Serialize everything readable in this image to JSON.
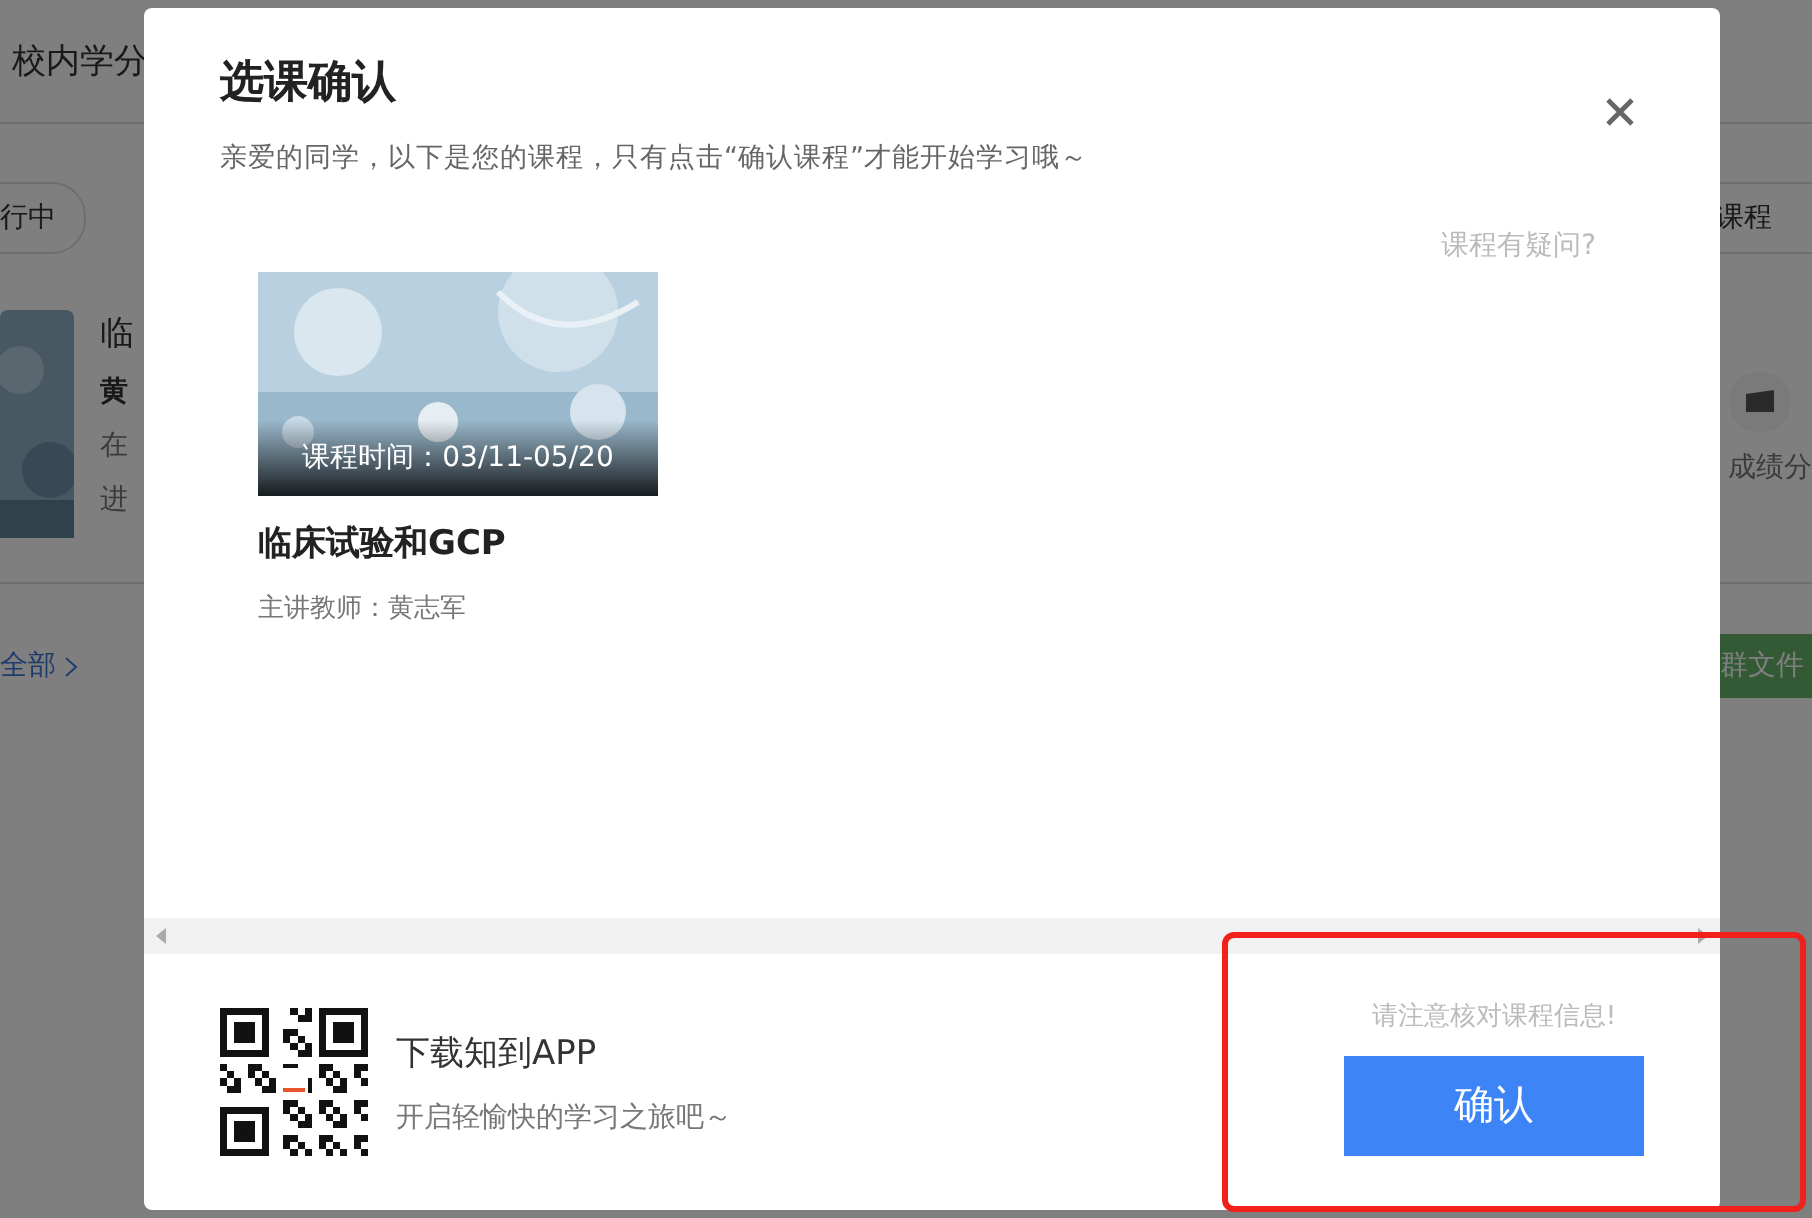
{
  "background_page": {
    "header_title": "校内学分",
    "filter_left": "行中",
    "filter_right": "课程",
    "course": {
      "title": "临",
      "teacher": "黄",
      "status": "在",
      "progress": "进"
    },
    "side_action": "成绩分",
    "view_all": "全部",
    "group_files": "群文件"
  },
  "dialog": {
    "title": "选课确认",
    "subtitle": "亲爱的同学，以下是您的课程，只有点击“确认课程”才能开始学习哦～",
    "question_link": "课程有疑问?",
    "courses": [
      {
        "caption": "课程时间：03/11-05/20",
        "title": "临床试验和GCP",
        "teacher": "主讲教师：黄志军"
      }
    ],
    "app_title": "下载知到APP",
    "app_slogan": "开启轻愉快的学习之旅吧～",
    "notice": "请注意核对课程信息!",
    "confirm": "确认"
  }
}
